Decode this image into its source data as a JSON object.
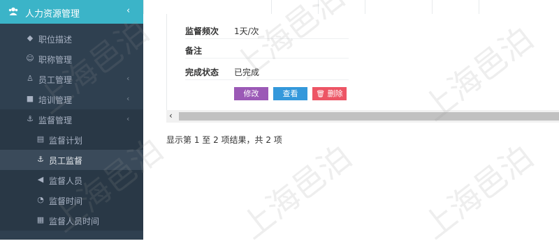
{
  "sidebar": {
    "header_label": "人力资源管理",
    "items": [
      {
        "label": "职位描述",
        "icon": "diamond-icon"
      },
      {
        "label": "职称管理",
        "icon": "users-icon"
      },
      {
        "label": "员工管理",
        "icon": "user-icon"
      },
      {
        "label": "培训管理",
        "icon": "briefcase-icon"
      },
      {
        "label": "监督管理",
        "icon": "anchor-icon"
      },
      {
        "label": "监督计划",
        "icon": "list-icon"
      },
      {
        "label": "员工监督",
        "icon": "anchor-icon"
      },
      {
        "label": "监督人员",
        "icon": "bullhorn-icon"
      },
      {
        "label": "监督时间",
        "icon": "bell-icon"
      },
      {
        "label": "监督人员时间",
        "icon": "calendar-icon"
      }
    ]
  },
  "detail": {
    "rows": [
      {
        "key": "监督频次",
        "value": "1天/次"
      },
      {
        "key": "备注",
        "value": ""
      },
      {
        "key": "完成状态",
        "value": "已完成"
      }
    ],
    "buttons": {
      "edit": "修改",
      "view": "查看",
      "delete": "删除"
    }
  },
  "pager": {
    "info": "显示第 1 至 2 项结果，共 2 项"
  },
  "watermark": "上海邑泊",
  "colors": {
    "sidebar_bg": "#2f4050",
    "header_bg": "#3bb4c8",
    "edit": "#9b59b6",
    "view": "#3498db",
    "delete": "#ed5565"
  }
}
